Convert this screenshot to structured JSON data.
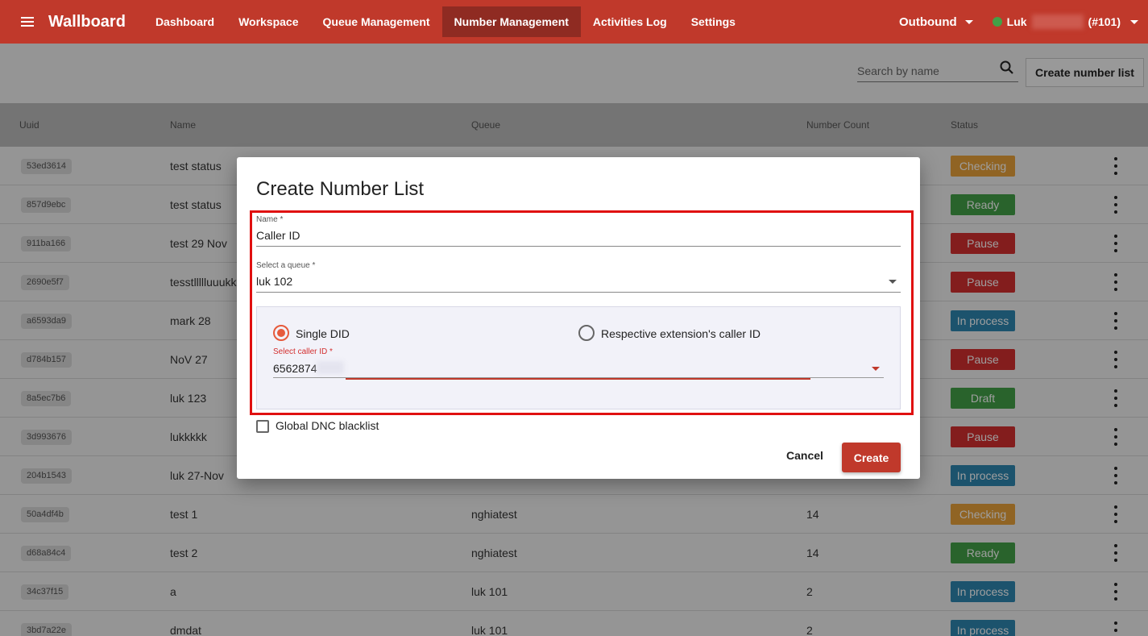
{
  "topbar": {
    "brand": "Wallboard",
    "nav": [
      "Dashboard",
      "Workspace",
      "Queue Management",
      "Number Management",
      "Activities Log",
      "Settings"
    ],
    "active_nav": "Number Management",
    "mode": "Outbound",
    "user_name": "Luk",
    "user_ext": "(#101)",
    "status_color": "#43a047"
  },
  "toolbar": {
    "search_placeholder": "Search by name",
    "create_label": "Create number list"
  },
  "table": {
    "headers": [
      "Uuid",
      "Name",
      "Queue",
      "Number Count",
      "Status"
    ],
    "rows": [
      {
        "uuid": "53ed3614",
        "name": "test status",
        "queue": "",
        "count": "",
        "status": "Checking"
      },
      {
        "uuid": "857d9ebc",
        "name": "test status",
        "queue": "",
        "count": "",
        "status": "Ready"
      },
      {
        "uuid": "911ba166",
        "name": "test 29 Nov",
        "queue": "",
        "count": "",
        "status": "Pause"
      },
      {
        "uuid": "2690e5f7",
        "name": "tesstllllluuukk",
        "queue": "",
        "count": "",
        "status": "Pause"
      },
      {
        "uuid": "a6593da9",
        "name": "mark 28",
        "queue": "",
        "count": "",
        "status": "In process"
      },
      {
        "uuid": "d784b157",
        "name": "NoV 27",
        "queue": "",
        "count": "",
        "status": "Pause"
      },
      {
        "uuid": "8a5ec7b6",
        "name": "luk 123",
        "queue": "",
        "count": "",
        "status": "Draft"
      },
      {
        "uuid": "3d993676",
        "name": "lukkkkk",
        "queue": "",
        "count": "",
        "status": "Pause"
      },
      {
        "uuid": "204b1543",
        "name": "luk 27-Nov",
        "queue": "",
        "count": "",
        "status": "In process"
      },
      {
        "uuid": "50a4df4b",
        "name": "test 1",
        "queue": "nghiatest",
        "count": "14",
        "status": "Checking"
      },
      {
        "uuid": "d68a84c4",
        "name": "test 2",
        "queue": "nghiatest",
        "count": "14",
        "status": "Ready"
      },
      {
        "uuid": "34c37f15",
        "name": "a",
        "queue": "luk 101",
        "count": "2",
        "status": "In process"
      },
      {
        "uuid": "3bd7a22e",
        "name": "dmdat",
        "queue": "luk 101",
        "count": "2",
        "status": "In process"
      }
    ],
    "status_colors": {
      "Checking": "#e8a23a",
      "Ready": "#43a047",
      "Pause": "#d32f2f",
      "In process": "#2e86b0",
      "Draft": "#43a047"
    }
  },
  "dialog": {
    "title": "Create Number List",
    "name_label": "Name *",
    "name_value": "Caller ID",
    "queue_label": "Select a queue *",
    "queue_value": "luk 102",
    "option_single": "Single DID",
    "option_respective": "Respective extension's caller ID",
    "caller_label": "Select caller ID *",
    "caller_value": "6562874",
    "blacklist_label": "Global DNC blacklist",
    "cancel_label": "Cancel",
    "create_label": "Create"
  }
}
